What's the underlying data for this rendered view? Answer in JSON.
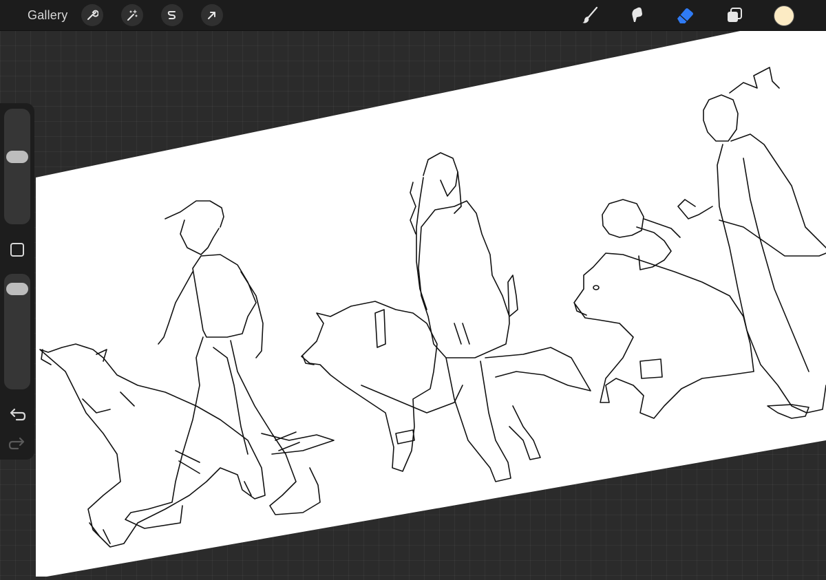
{
  "topbar": {
    "gallery_label": "Gallery",
    "left_tools": [
      {
        "icon": "wrench-icon",
        "name": "actions"
      },
      {
        "icon": "magic-wand-icon",
        "name": "adjustments"
      },
      {
        "icon": "selection-s-icon",
        "name": "selection"
      },
      {
        "icon": "arrow-cursor-icon",
        "name": "transform"
      }
    ],
    "right_tools": [
      {
        "icon": "brush-icon",
        "name": "brush",
        "active": false
      },
      {
        "icon": "smudge-icon",
        "name": "smudge",
        "active": false
      },
      {
        "icon": "eraser-icon",
        "name": "eraser",
        "active": true
      },
      {
        "icon": "layers-icon",
        "name": "layers",
        "active": false
      }
    ],
    "current_color": "#fcebc4"
  },
  "sidebar": {
    "brush_size_level": 0.6,
    "opacity_level": 0.95,
    "undo_icon": "undo-arrow-icon",
    "redo_icon": "redo-arrow-icon",
    "modify_icon": "square-icon"
  },
  "colors": {
    "accent_active": "#2f7bf5",
    "topbar_bg": "#1c1c1c",
    "workspace_bg": "#2b2b2b",
    "paper": "#ffffff",
    "ink": "#111111"
  }
}
